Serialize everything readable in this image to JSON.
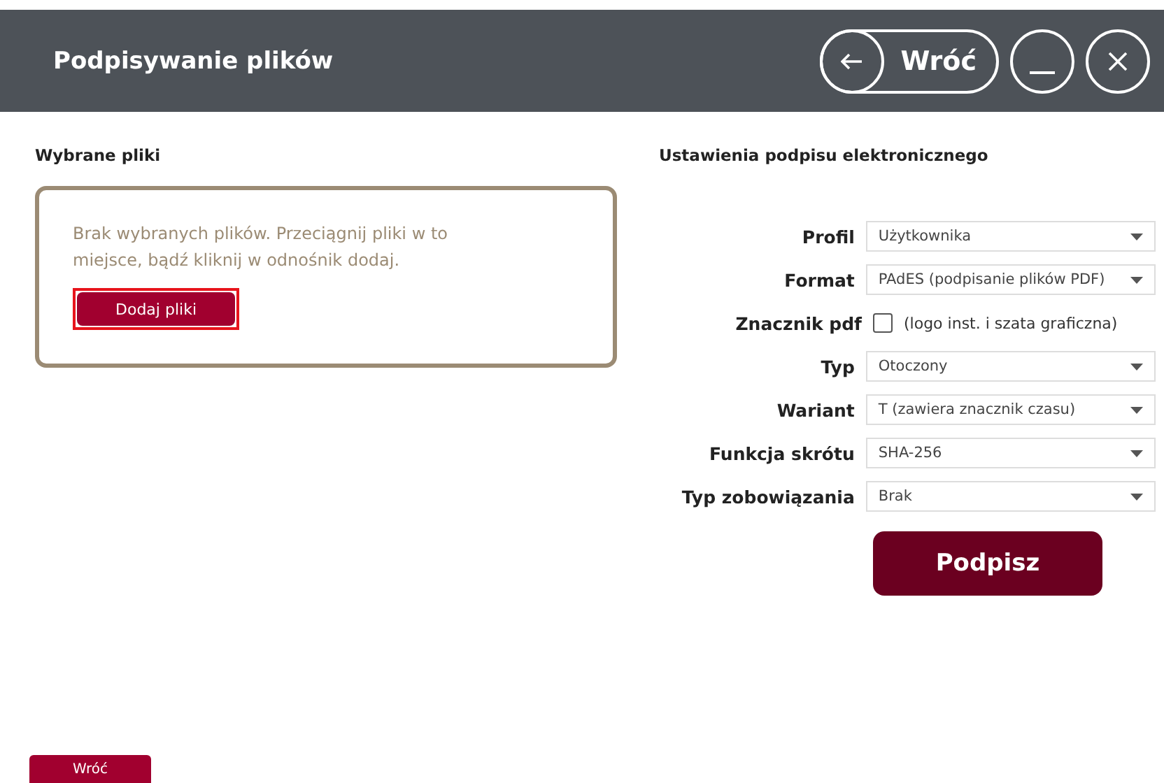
{
  "header": {
    "title": "Podpisywanie plików",
    "back_button": "Wróć"
  },
  "selected_files": {
    "heading": "Wybrane pliki",
    "message": "Brak wybranych plików. Przeciągnij pliki w to miejsce, bądź kliknij w odnośnik dodaj.",
    "add_button": "Dodaj pliki"
  },
  "settings": {
    "heading": "Ustawienia podpisu elektronicznego",
    "fields": [
      {
        "kind": "select",
        "label": "Profil",
        "value": "Użytkownika"
      },
      {
        "kind": "select",
        "label": "Format",
        "value": "PAdES (podpisanie plików PDF)"
      },
      {
        "kind": "checkbox",
        "label": "Znacznik pdf",
        "checked": false,
        "note": "(logo inst. i szata graficzna)"
      },
      {
        "kind": "select",
        "label": "Typ",
        "value": "Otoczony"
      },
      {
        "kind": "select",
        "label": "Wariant",
        "value": "T (zawiera znacznik czasu)"
      },
      {
        "kind": "select",
        "label": "Funkcja skrótu",
        "value": "SHA-256"
      },
      {
        "kind": "select",
        "label": "Typ zobowiązania",
        "value": "Brak"
      }
    ],
    "sign_button": "Podpisz"
  },
  "footer": {
    "back_button": "Wróć"
  }
}
